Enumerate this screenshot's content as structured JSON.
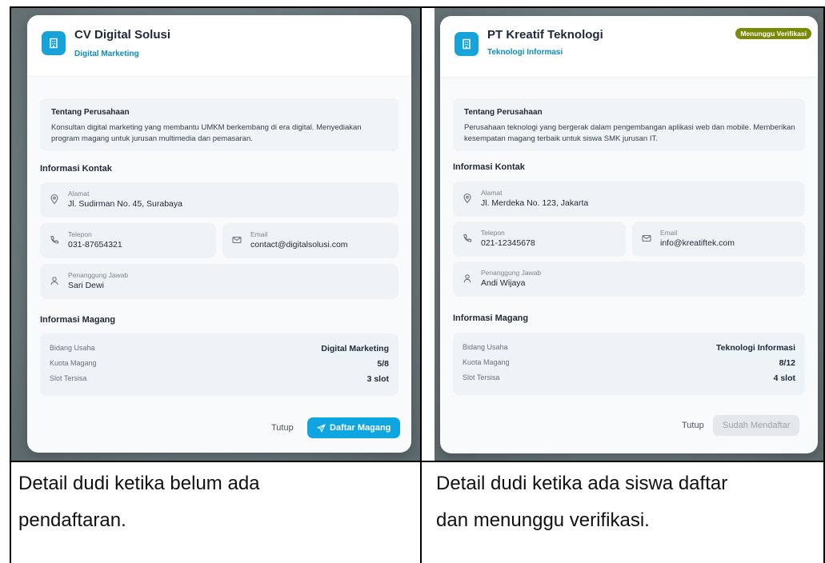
{
  "left": {
    "company_name": "CV Digital Solusi",
    "company_field": "Digital Marketing",
    "status_badge": "",
    "about_title": "Tentang Perusahaan",
    "about_text": "Konsultan digital marketing yang membantu UMKM berkembang di era digital. Menyediakan program magang untuk jurusan multimedia dan pemasaran.",
    "contact_title": "Informasi Kontak",
    "address_label": "Alamat",
    "address_value": "Jl. Sudirman No. 45, Surabaya",
    "phone_label": "Telepon",
    "phone_value": "031-87654321",
    "email_label": "Email",
    "email_value": "contact@digitalsolusi.com",
    "pic_label": "Penanggung Jawab",
    "pic_value": "Sari Dewi",
    "magang_title": "Informasi Magang",
    "rows": [
      {
        "label": "Bidang Usaha",
        "value": "Digital Marketing"
      },
      {
        "label": "Kuota Magang",
        "value": "5/8"
      },
      {
        "label": "Slot Tersisa",
        "value": "3 slot"
      }
    ],
    "close_button": "Tutup",
    "primary_button": "Daftar Magang"
  },
  "right": {
    "company_name": "PT Kreatif Teknologi",
    "company_field": "Teknologi Informasi",
    "status_badge": "Menunggu Verifikasi",
    "about_title": "Tentang Perusahaan",
    "about_text": "Perusahaan teknologi yang bergerak dalam pengembangan aplikasi web dan mobile. Memberikan kesempatan magang terbaik untuk siswa SMK jurusan IT.",
    "contact_title": "Informasi Kontak",
    "address_label": "Alamat",
    "address_value": "Jl. Merdeka No. 123, Jakarta",
    "phone_label": "Telepon",
    "phone_value": "021-12345678",
    "email_label": "Email",
    "email_value": "info@kreatiftek.com",
    "pic_label": "Penanggung Jawab",
    "pic_value": "Andi Wijaya",
    "magang_title": "Informasi Magang",
    "rows": [
      {
        "label": "Bidang Usaha",
        "value": "Teknologi Informasi"
      },
      {
        "label": "Kuota Magang",
        "value": "8/12"
      },
      {
        "label": "Slot Tersisa",
        "value": "4 slot"
      }
    ],
    "close_button": "Tutup",
    "primary_button": "Sudah Mendaftar"
  },
  "captions": {
    "left": [
      "Detail dudi ketika belum ada",
      "pendaftaran."
    ],
    "right": [
      "Detail dudi ketika ada siswa daftar",
      "dan menunggu verifikasi."
    ]
  },
  "colors": {
    "accent": "#0ea5e0",
    "badge": "#7a8a06",
    "disabled_button": "#e5e8eb"
  },
  "icons": {
    "logo": "building-icon",
    "address": "map-pin-icon",
    "phone": "phone-icon",
    "email": "mail-icon",
    "pic": "user-icon",
    "send": "send-icon"
  }
}
